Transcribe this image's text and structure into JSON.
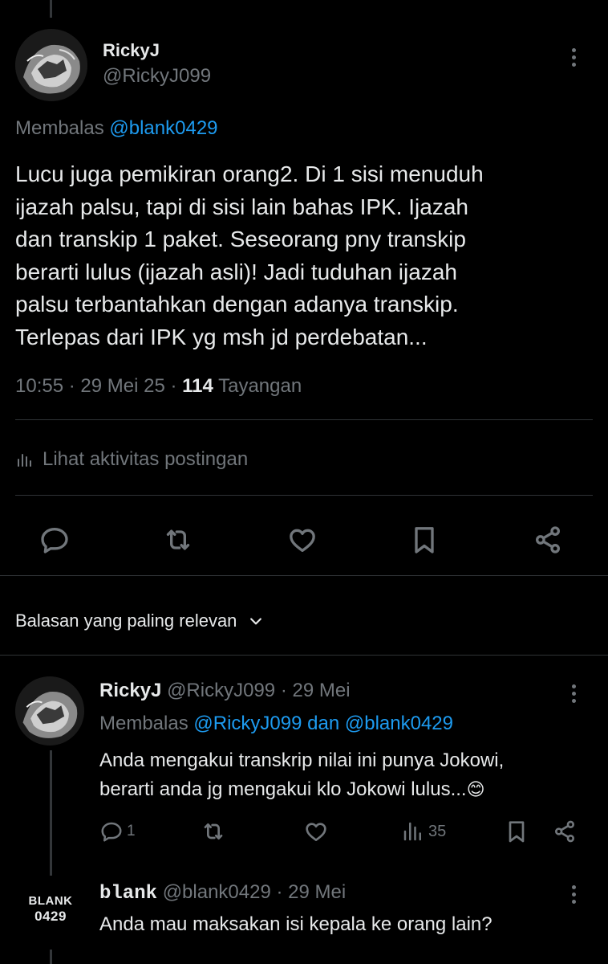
{
  "main_post": {
    "display_name": "RickyJ",
    "handle": "@RickyJ099",
    "replying_prefix": "Membalas",
    "replying_to": "@blank0429",
    "body_lines": [
      "Lucu juga pemikiran orang2. Di 1 sisi menuduh",
      "ijazah palsu, tapi di sisi lain bahas IPK. Ijazah",
      "dan transkip 1 paket. Seseorang pny transkip",
      "berarti lulus (ijazah asli)! Jadi tuduhan ijazah",
      "palsu terbantahkan dengan adanya transkip.",
      "Terlepas dari IPK yg msh jd perdebatan..."
    ],
    "time": "10:55",
    "sep1": "·",
    "date": "29 Mei 25",
    "sep2": "·",
    "views_count": "114",
    "views_label": "Tayangan",
    "activity_label": "Lihat aktivitas postingan"
  },
  "replies_header": {
    "label": "Balasan yang paling relevan"
  },
  "reply1": {
    "display_name": "RickyJ",
    "handle": "@RickyJ099",
    "sep": "·",
    "date": "29 Mei",
    "replying_prefix": "Membalas",
    "replying_to_1": "@RickyJ099",
    "replying_join": "dan",
    "replying_to_2": "@blank0429",
    "body_line1": "Anda mengakui transkrip nilai ini punya Jokowi,",
    "body_line2": "berarti anda jg mengakui klo Jokowi lulus...",
    "emoji": "😊",
    "reply_count": "1",
    "views_count": "35"
  },
  "reply2": {
    "avatar_line1": "BLANK",
    "avatar_line2": "0429",
    "display_name": "blank",
    "handle": "@blank0429",
    "sep": "·",
    "date": "29 Mei",
    "body": "Anda mau maksakan isi kepala ke orang lain?"
  },
  "colors": {
    "background": "#000000",
    "text": "#e7e9ea",
    "muted": "#71767b",
    "link": "#1d9bf0",
    "divider": "#2f3336"
  },
  "icons": [
    "reply-icon",
    "repost-icon",
    "like-icon",
    "bookmark-icon",
    "share-icon",
    "analytics-icon",
    "chevron-down-icon",
    "more-icon",
    "smiling-face-emoji"
  ]
}
